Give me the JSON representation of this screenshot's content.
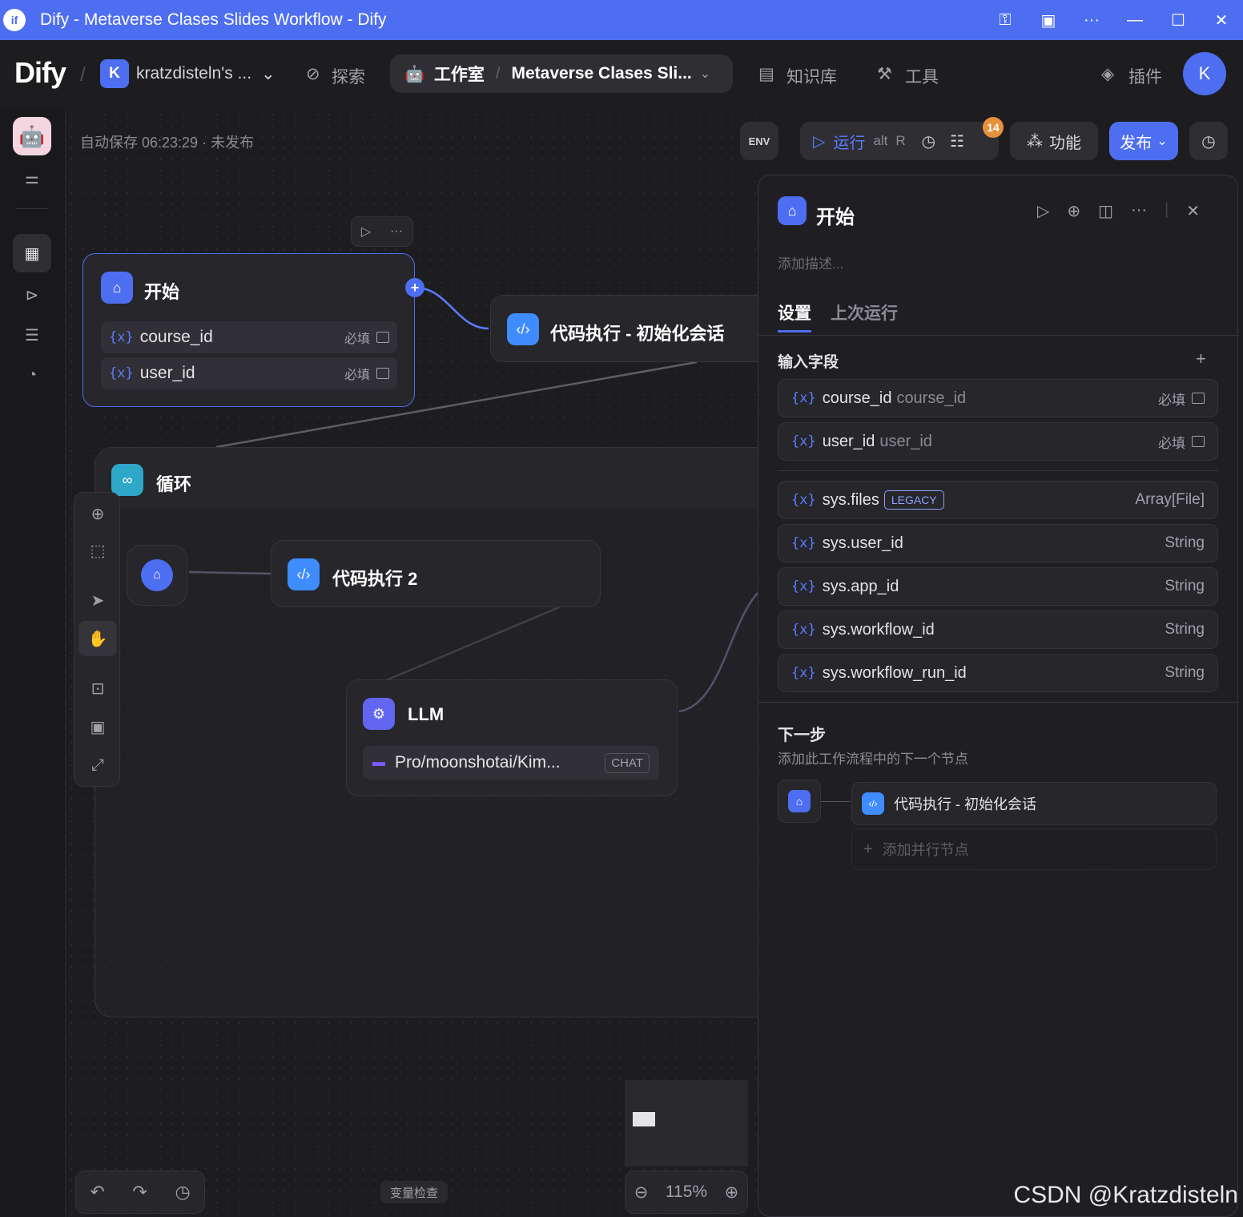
{
  "window": {
    "title": "Dify - Metaverse Clases Slides Workflow - Dify",
    "app_icon": "if"
  },
  "nav": {
    "logo": "Dify",
    "workspace_badge": "K",
    "workspace_name": "kratzdisteln's ...",
    "explore": "探索",
    "studio": "工作室",
    "app_name": "Metaverse Clases Sli...",
    "knowledge": "知识库",
    "tools": "工具",
    "plugins": "插件",
    "avatar": "K"
  },
  "canvas": {
    "autosave": "自动保存 06:23:29 · 未发布",
    "start_node": {
      "title": "开始",
      "vars": [
        {
          "icon": "{x}",
          "name": "course_id",
          "required": "必填"
        },
        {
          "icon": "{x}",
          "name": "user_id",
          "required": "必填"
        }
      ]
    },
    "code_init_node": {
      "title": "代码执行 - 初始化会话"
    },
    "loop_node": {
      "title": "循环"
    },
    "code2_node": {
      "title": "代码执行 2"
    },
    "llm_node": {
      "title": "LLM",
      "model": "Pro/moonshotai/Kim...",
      "mode": "CHAT"
    },
    "zoom": "115%",
    "var_inspect": "变量检查"
  },
  "actions": {
    "env": "ENV",
    "run": "运行",
    "run_shortcut_1": "alt",
    "run_shortcut_2": "R",
    "checklist_count": "14",
    "features": "功能",
    "publish": "发布"
  },
  "panel": {
    "title": "开始",
    "desc_placeholder": "添加描述...",
    "tabs": [
      "设置",
      "上次运行"
    ],
    "input_section": "输入字段",
    "input_fields": [
      {
        "name": "course_id",
        "alias": "course_id",
        "tag": "必填"
      },
      {
        "name": "user_id",
        "alias": "user_id",
        "tag": "必填"
      }
    ],
    "system_fields": [
      {
        "name": "sys.files",
        "badge": "LEGACY",
        "type": "Array[File]"
      },
      {
        "name": "sys.user_id",
        "type": "String"
      },
      {
        "name": "sys.app_id",
        "type": "String"
      },
      {
        "name": "sys.workflow_id",
        "type": "String"
      },
      {
        "name": "sys.workflow_run_id",
        "type": "String"
      }
    ],
    "next_step_title": "下一步",
    "next_step_desc": "添加此工作流程中的下一个节点",
    "next_node": "代码执行 - 初始化会话",
    "add_parallel": "添加并行节点"
  },
  "watermark": "CSDN @Kratzdisteln"
}
